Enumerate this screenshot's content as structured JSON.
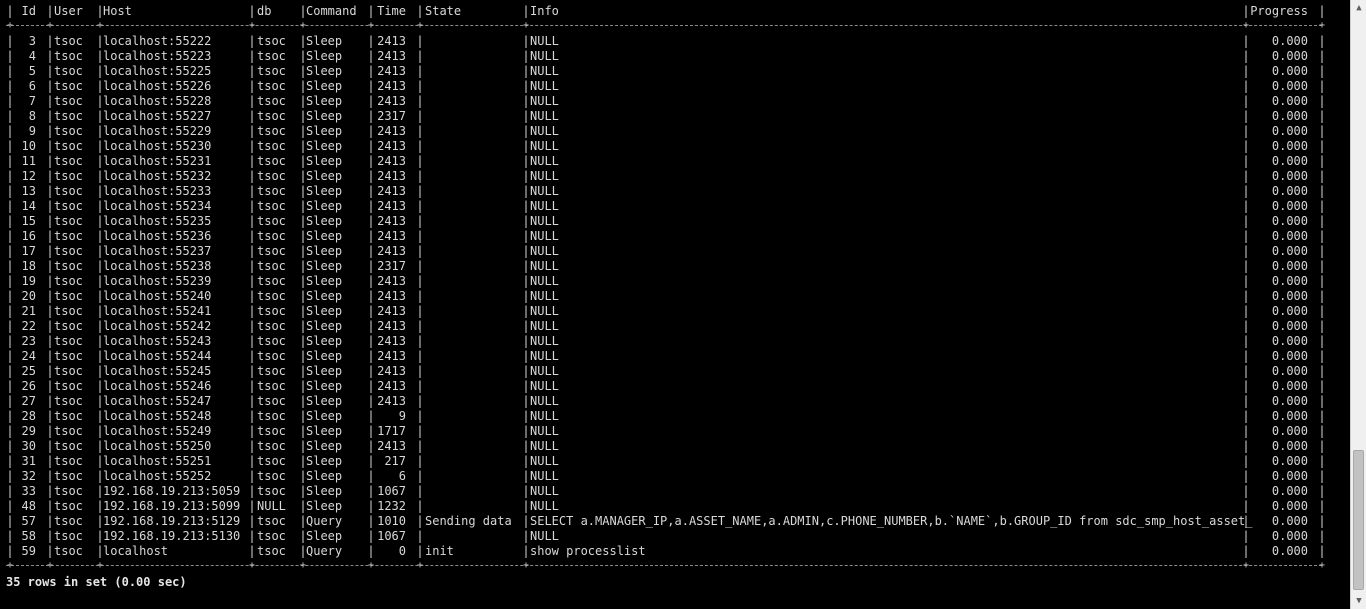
{
  "terminal": {
    "columns": [
      "Id",
      "User",
      "Host",
      "db",
      "Command",
      "Time",
      "State",
      "Info",
      "Progress"
    ],
    "rows": [
      {
        "id": "3",
        "user": "tsoc",
        "host": "localhost:55222",
        "db": "tsoc",
        "command": "Sleep",
        "time": "2413",
        "state": "",
        "info": "NULL",
        "progress": "0.000"
      },
      {
        "id": "4",
        "user": "tsoc",
        "host": "localhost:55223",
        "db": "tsoc",
        "command": "Sleep",
        "time": "2413",
        "state": "",
        "info": "NULL",
        "progress": "0.000"
      },
      {
        "id": "5",
        "user": "tsoc",
        "host": "localhost:55225",
        "db": "tsoc",
        "command": "Sleep",
        "time": "2413",
        "state": "",
        "info": "NULL",
        "progress": "0.000"
      },
      {
        "id": "6",
        "user": "tsoc",
        "host": "localhost:55226",
        "db": "tsoc",
        "command": "Sleep",
        "time": "2413",
        "state": "",
        "info": "NULL",
        "progress": "0.000"
      },
      {
        "id": "7",
        "user": "tsoc",
        "host": "localhost:55228",
        "db": "tsoc",
        "command": "Sleep",
        "time": "2413",
        "state": "",
        "info": "NULL",
        "progress": "0.000"
      },
      {
        "id": "8",
        "user": "tsoc",
        "host": "localhost:55227",
        "db": "tsoc",
        "command": "Sleep",
        "time": "2317",
        "state": "",
        "info": "NULL",
        "progress": "0.000"
      },
      {
        "id": "9",
        "user": "tsoc",
        "host": "localhost:55229",
        "db": "tsoc",
        "command": "Sleep",
        "time": "2413",
        "state": "",
        "info": "NULL",
        "progress": "0.000"
      },
      {
        "id": "10",
        "user": "tsoc",
        "host": "localhost:55230",
        "db": "tsoc",
        "command": "Sleep",
        "time": "2413",
        "state": "",
        "info": "NULL",
        "progress": "0.000"
      },
      {
        "id": "11",
        "user": "tsoc",
        "host": "localhost:55231",
        "db": "tsoc",
        "command": "Sleep",
        "time": "2413",
        "state": "",
        "info": "NULL",
        "progress": "0.000"
      },
      {
        "id": "12",
        "user": "tsoc",
        "host": "localhost:55232",
        "db": "tsoc",
        "command": "Sleep",
        "time": "2413",
        "state": "",
        "info": "NULL",
        "progress": "0.000"
      },
      {
        "id": "13",
        "user": "tsoc",
        "host": "localhost:55233",
        "db": "tsoc",
        "command": "Sleep",
        "time": "2413",
        "state": "",
        "info": "NULL",
        "progress": "0.000"
      },
      {
        "id": "14",
        "user": "tsoc",
        "host": "localhost:55234",
        "db": "tsoc",
        "command": "Sleep",
        "time": "2413",
        "state": "",
        "info": "NULL",
        "progress": "0.000"
      },
      {
        "id": "15",
        "user": "tsoc",
        "host": "localhost:55235",
        "db": "tsoc",
        "command": "Sleep",
        "time": "2413",
        "state": "",
        "info": "NULL",
        "progress": "0.000"
      },
      {
        "id": "16",
        "user": "tsoc",
        "host": "localhost:55236",
        "db": "tsoc",
        "command": "Sleep",
        "time": "2413",
        "state": "",
        "info": "NULL",
        "progress": "0.000"
      },
      {
        "id": "17",
        "user": "tsoc",
        "host": "localhost:55237",
        "db": "tsoc",
        "command": "Sleep",
        "time": "2413",
        "state": "",
        "info": "NULL",
        "progress": "0.000"
      },
      {
        "id": "18",
        "user": "tsoc",
        "host": "localhost:55238",
        "db": "tsoc",
        "command": "Sleep",
        "time": "2317",
        "state": "",
        "info": "NULL",
        "progress": "0.000"
      },
      {
        "id": "19",
        "user": "tsoc",
        "host": "localhost:55239",
        "db": "tsoc",
        "command": "Sleep",
        "time": "2413",
        "state": "",
        "info": "NULL",
        "progress": "0.000"
      },
      {
        "id": "20",
        "user": "tsoc",
        "host": "localhost:55240",
        "db": "tsoc",
        "command": "Sleep",
        "time": "2413",
        "state": "",
        "info": "NULL",
        "progress": "0.000"
      },
      {
        "id": "21",
        "user": "tsoc",
        "host": "localhost:55241",
        "db": "tsoc",
        "command": "Sleep",
        "time": "2413",
        "state": "",
        "info": "NULL",
        "progress": "0.000"
      },
      {
        "id": "22",
        "user": "tsoc",
        "host": "localhost:55242",
        "db": "tsoc",
        "command": "Sleep",
        "time": "2413",
        "state": "",
        "info": "NULL",
        "progress": "0.000"
      },
      {
        "id": "23",
        "user": "tsoc",
        "host": "localhost:55243",
        "db": "tsoc",
        "command": "Sleep",
        "time": "2413",
        "state": "",
        "info": "NULL",
        "progress": "0.000"
      },
      {
        "id": "24",
        "user": "tsoc",
        "host": "localhost:55244",
        "db": "tsoc",
        "command": "Sleep",
        "time": "2413",
        "state": "",
        "info": "NULL",
        "progress": "0.000"
      },
      {
        "id": "25",
        "user": "tsoc",
        "host": "localhost:55245",
        "db": "tsoc",
        "command": "Sleep",
        "time": "2413",
        "state": "",
        "info": "NULL",
        "progress": "0.000"
      },
      {
        "id": "26",
        "user": "tsoc",
        "host": "localhost:55246",
        "db": "tsoc",
        "command": "Sleep",
        "time": "2413",
        "state": "",
        "info": "NULL",
        "progress": "0.000"
      },
      {
        "id": "27",
        "user": "tsoc",
        "host": "localhost:55247",
        "db": "tsoc",
        "command": "Sleep",
        "time": "2413",
        "state": "",
        "info": "NULL",
        "progress": "0.000"
      },
      {
        "id": "28",
        "user": "tsoc",
        "host": "localhost:55248",
        "db": "tsoc",
        "command": "Sleep",
        "time": "9",
        "state": "",
        "info": "NULL",
        "progress": "0.000"
      },
      {
        "id": "29",
        "user": "tsoc",
        "host": "localhost:55249",
        "db": "tsoc",
        "command": "Sleep",
        "time": "1717",
        "state": "",
        "info": "NULL",
        "progress": "0.000"
      },
      {
        "id": "30",
        "user": "tsoc",
        "host": "localhost:55250",
        "db": "tsoc",
        "command": "Sleep",
        "time": "2413",
        "state": "",
        "info": "NULL",
        "progress": "0.000"
      },
      {
        "id": "31",
        "user": "tsoc",
        "host": "localhost:55251",
        "db": "tsoc",
        "command": "Sleep",
        "time": "217",
        "state": "",
        "info": "NULL",
        "progress": "0.000"
      },
      {
        "id": "32",
        "user": "tsoc",
        "host": "localhost:55252",
        "db": "tsoc",
        "command": "Sleep",
        "time": "6",
        "state": "",
        "info": "NULL",
        "progress": "0.000"
      },
      {
        "id": "33",
        "user": "tsoc",
        "host": "192.168.19.213:5059",
        "db": "tsoc",
        "command": "Sleep",
        "time": "1067",
        "state": "",
        "info": "NULL",
        "progress": "0.000"
      },
      {
        "id": "48",
        "user": "tsoc",
        "host": "192.168.19.213:5099",
        "db": "NULL",
        "command": "Sleep",
        "time": "1232",
        "state": "",
        "info": "NULL",
        "progress": "0.000"
      },
      {
        "id": "57",
        "user": "tsoc",
        "host": "192.168.19.213:5129",
        "db": "tsoc",
        "command": "Query",
        "time": "1010",
        "state": "Sending data",
        "info": "SELECT a.MANAGER_IP,a.ASSET_NAME,a.ADMIN,c.PHONE_NUMBER,b.`NAME`,b.GROUP_ID from sdc_smp_host_asset_",
        "progress": "0.000"
      },
      {
        "id": "58",
        "user": "tsoc",
        "host": "192.168.19.213:5130",
        "db": "tsoc",
        "command": "Sleep",
        "time": "1067",
        "state": "",
        "info": "NULL",
        "progress": "0.000"
      },
      {
        "id": "59",
        "user": "tsoc",
        "host": "localhost",
        "db": "tsoc",
        "command": "Query",
        "time": "0",
        "state": "init",
        "info": "show processlist",
        "progress": "0.000"
      }
    ],
    "footer": "35 rows in set (0.00 sec)"
  },
  "scrollbar": {
    "up_icon": "triangle-up-icon",
    "down_icon": "triangle-down-icon",
    "position_fraction": 0.93
  },
  "colors": {
    "background": "#000000",
    "text": "#d8d8d8",
    "rule": "#8a8a8a",
    "scrollbar_track": "#f0f0f0"
  }
}
